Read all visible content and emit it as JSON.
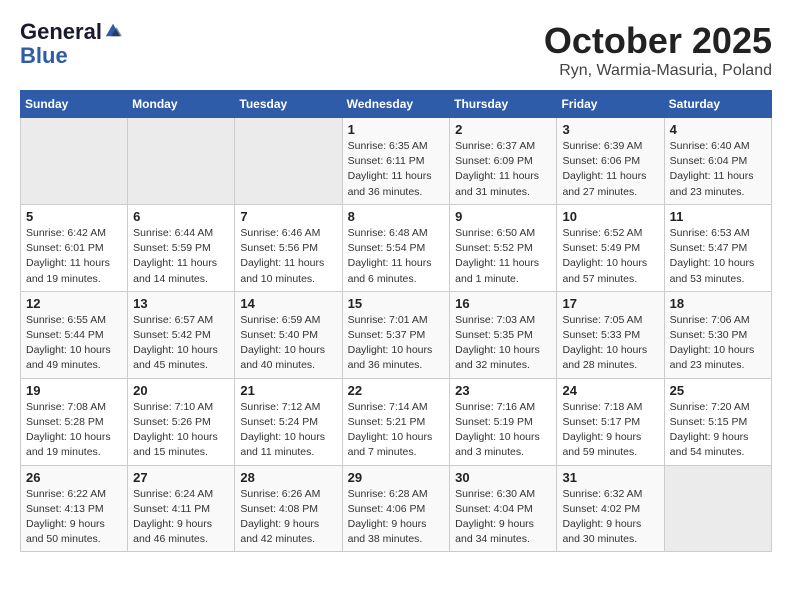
{
  "header": {
    "logo_line1": "General",
    "logo_line2": "Blue",
    "title": "October 2025",
    "subtitle": "Ryn, Warmia-Masuria, Poland"
  },
  "days_of_week": [
    "Sunday",
    "Monday",
    "Tuesday",
    "Wednesday",
    "Thursday",
    "Friday",
    "Saturday"
  ],
  "weeks": [
    {
      "days": [
        {
          "number": "",
          "empty": true
        },
        {
          "number": "",
          "empty": true
        },
        {
          "number": "",
          "empty": true
        },
        {
          "number": "1",
          "sunrise": "6:35 AM",
          "sunset": "6:11 PM",
          "daylight": "11 hours and 36 minutes."
        },
        {
          "number": "2",
          "sunrise": "6:37 AM",
          "sunset": "6:09 PM",
          "daylight": "11 hours and 31 minutes."
        },
        {
          "number": "3",
          "sunrise": "6:39 AM",
          "sunset": "6:06 PM",
          "daylight": "11 hours and 27 minutes."
        },
        {
          "number": "4",
          "sunrise": "6:40 AM",
          "sunset": "6:04 PM",
          "daylight": "11 hours and 23 minutes."
        }
      ]
    },
    {
      "days": [
        {
          "number": "5",
          "sunrise": "6:42 AM",
          "sunset": "6:01 PM",
          "daylight": "11 hours and 19 minutes."
        },
        {
          "number": "6",
          "sunrise": "6:44 AM",
          "sunset": "5:59 PM",
          "daylight": "11 hours and 14 minutes."
        },
        {
          "number": "7",
          "sunrise": "6:46 AM",
          "sunset": "5:56 PM",
          "daylight": "11 hours and 10 minutes."
        },
        {
          "number": "8",
          "sunrise": "6:48 AM",
          "sunset": "5:54 PM",
          "daylight": "11 hours and 6 minutes."
        },
        {
          "number": "9",
          "sunrise": "6:50 AM",
          "sunset": "5:52 PM",
          "daylight": "11 hours and 1 minute."
        },
        {
          "number": "10",
          "sunrise": "6:52 AM",
          "sunset": "5:49 PM",
          "daylight": "10 hours and 57 minutes."
        },
        {
          "number": "11",
          "sunrise": "6:53 AM",
          "sunset": "5:47 PM",
          "daylight": "10 hours and 53 minutes."
        }
      ]
    },
    {
      "days": [
        {
          "number": "12",
          "sunrise": "6:55 AM",
          "sunset": "5:44 PM",
          "daylight": "10 hours and 49 minutes."
        },
        {
          "number": "13",
          "sunrise": "6:57 AM",
          "sunset": "5:42 PM",
          "daylight": "10 hours and 45 minutes."
        },
        {
          "number": "14",
          "sunrise": "6:59 AM",
          "sunset": "5:40 PM",
          "daylight": "10 hours and 40 minutes."
        },
        {
          "number": "15",
          "sunrise": "7:01 AM",
          "sunset": "5:37 PM",
          "daylight": "10 hours and 36 minutes."
        },
        {
          "number": "16",
          "sunrise": "7:03 AM",
          "sunset": "5:35 PM",
          "daylight": "10 hours and 32 minutes."
        },
        {
          "number": "17",
          "sunrise": "7:05 AM",
          "sunset": "5:33 PM",
          "daylight": "10 hours and 28 minutes."
        },
        {
          "number": "18",
          "sunrise": "7:06 AM",
          "sunset": "5:30 PM",
          "daylight": "10 hours and 23 minutes."
        }
      ]
    },
    {
      "days": [
        {
          "number": "19",
          "sunrise": "7:08 AM",
          "sunset": "5:28 PM",
          "daylight": "10 hours and 19 minutes."
        },
        {
          "number": "20",
          "sunrise": "7:10 AM",
          "sunset": "5:26 PM",
          "daylight": "10 hours and 15 minutes."
        },
        {
          "number": "21",
          "sunrise": "7:12 AM",
          "sunset": "5:24 PM",
          "daylight": "10 hours and 11 minutes."
        },
        {
          "number": "22",
          "sunrise": "7:14 AM",
          "sunset": "5:21 PM",
          "daylight": "10 hours and 7 minutes."
        },
        {
          "number": "23",
          "sunrise": "7:16 AM",
          "sunset": "5:19 PM",
          "daylight": "10 hours and 3 minutes."
        },
        {
          "number": "24",
          "sunrise": "7:18 AM",
          "sunset": "5:17 PM",
          "daylight": "9 hours and 59 minutes."
        },
        {
          "number": "25",
          "sunrise": "7:20 AM",
          "sunset": "5:15 PM",
          "daylight": "9 hours and 54 minutes."
        }
      ]
    },
    {
      "days": [
        {
          "number": "26",
          "sunrise": "6:22 AM",
          "sunset": "4:13 PM",
          "daylight": "9 hours and 50 minutes."
        },
        {
          "number": "27",
          "sunrise": "6:24 AM",
          "sunset": "4:11 PM",
          "daylight": "9 hours and 46 minutes."
        },
        {
          "number": "28",
          "sunrise": "6:26 AM",
          "sunset": "4:08 PM",
          "daylight": "9 hours and 42 minutes."
        },
        {
          "number": "29",
          "sunrise": "6:28 AM",
          "sunset": "4:06 PM",
          "daylight": "9 hours and 38 minutes."
        },
        {
          "number": "30",
          "sunrise": "6:30 AM",
          "sunset": "4:04 PM",
          "daylight": "9 hours and 34 minutes."
        },
        {
          "number": "31",
          "sunrise": "6:32 AM",
          "sunset": "4:02 PM",
          "daylight": "9 hours and 30 minutes."
        },
        {
          "number": "",
          "empty": true
        }
      ]
    }
  ]
}
